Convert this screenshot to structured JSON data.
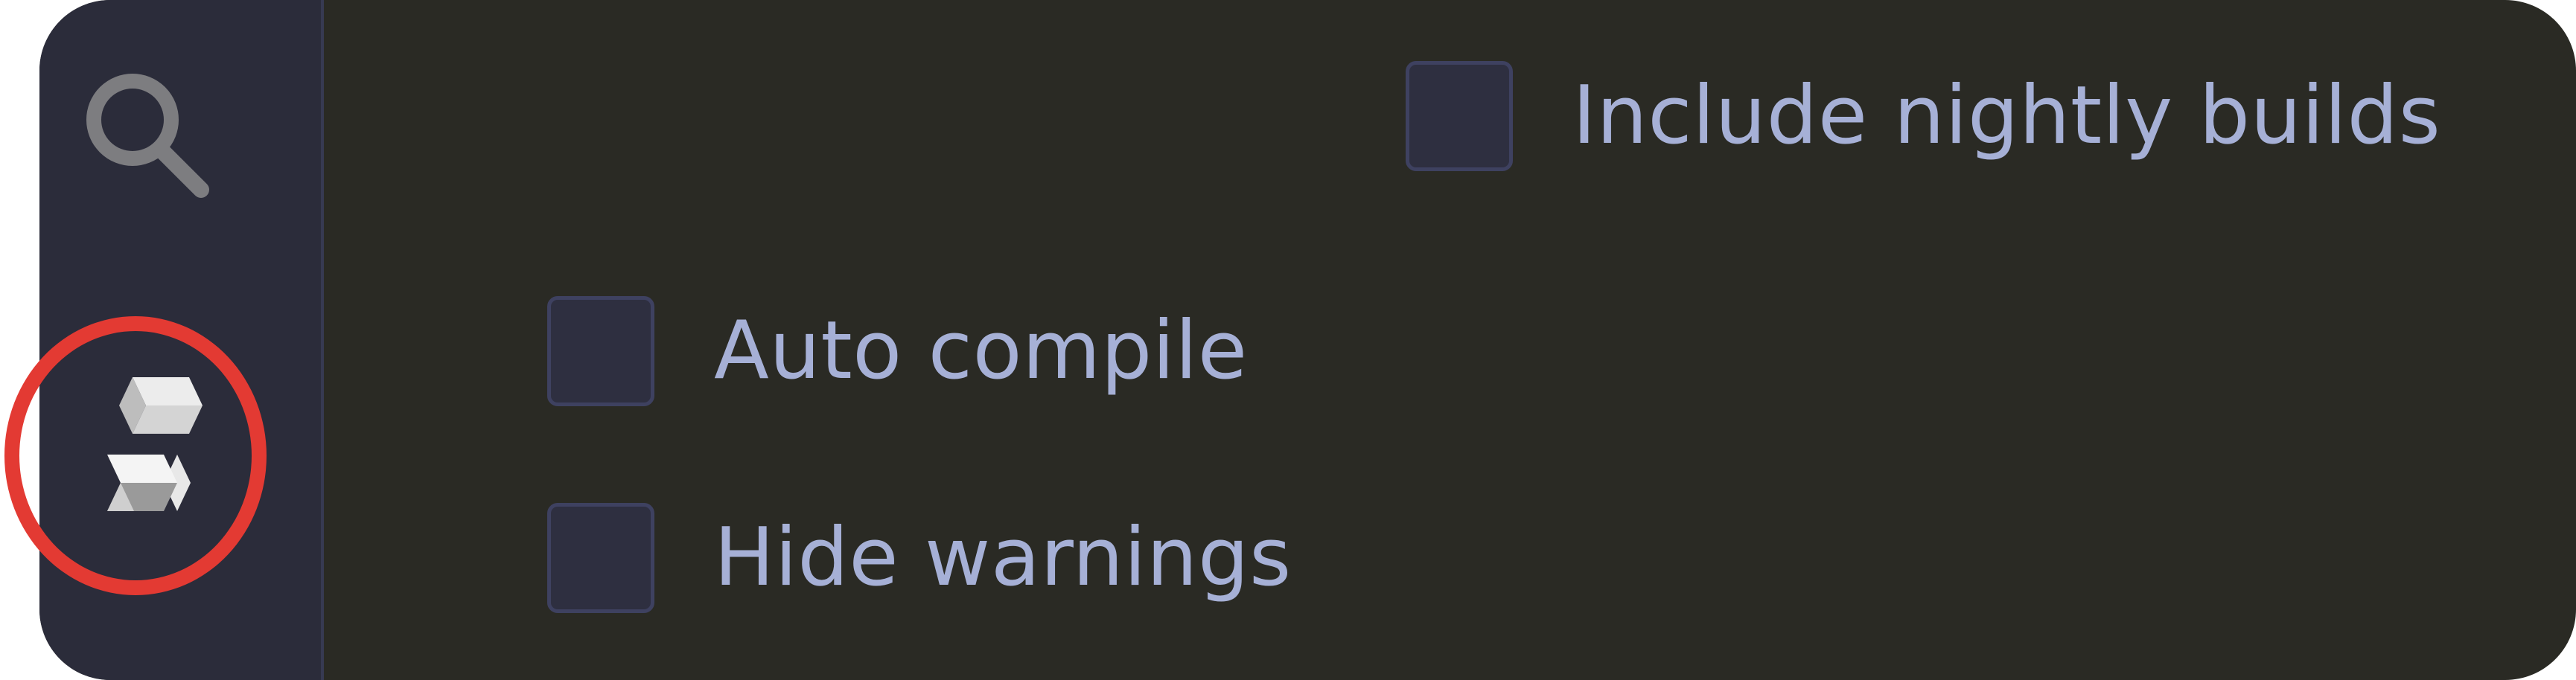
{
  "sidebar": {
    "items": [
      {
        "icon": "search-icon"
      },
      {
        "icon": "solidity-compiler-icon"
      }
    ]
  },
  "options": {
    "include_nightly_builds": {
      "label": "Include nightly builds",
      "checked": false
    },
    "auto_compile": {
      "label": "Auto compile",
      "checked": false
    },
    "hide_warnings": {
      "label": "Hide warnings",
      "checked": false
    }
  },
  "colors": {
    "panel_background": "#2a2a24",
    "sidebar_background": "#2b2c3a",
    "label_text": "#a6b0d6",
    "checkbox_fill": "#2e2f40",
    "checkbox_border": "#3e4160",
    "highlight_ring": "#e33a33"
  }
}
